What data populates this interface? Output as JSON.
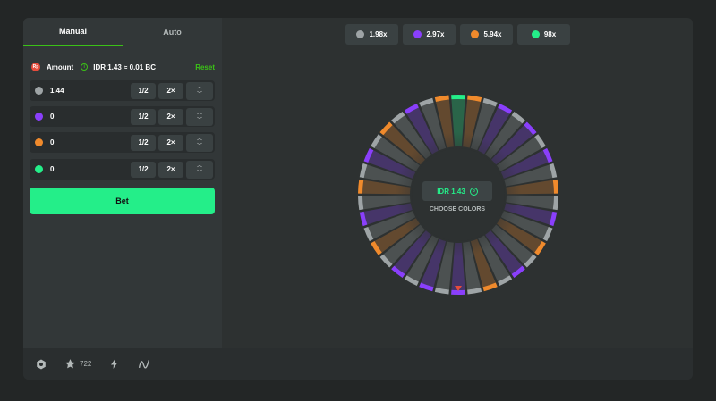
{
  "tabs": [
    {
      "label": "Manual",
      "active": true
    },
    {
      "label": "Auto",
      "active": false
    }
  ],
  "amount": {
    "label": "Amount",
    "coin_symbol": "Rp",
    "conversion": "IDR 1.43 ≈ 0.01 BC",
    "reset_label": "Reset"
  },
  "bets": [
    {
      "color": "#9ea4a6",
      "value": "1.44",
      "half": "1/2",
      "double": "2×",
      "up": "︿",
      "down": "﹀"
    },
    {
      "color": "#8a3ffc",
      "value": "0",
      "half": "1/2",
      "double": "2×",
      "up": "︿",
      "down": "﹀"
    },
    {
      "color": "#f08a2c",
      "value": "0",
      "half": "1/2",
      "double": "2×",
      "up": "︿",
      "down": "﹀"
    },
    {
      "color": "#24ee89",
      "value": "0",
      "half": "1/2",
      "double": "2×",
      "up": "︿",
      "down": "﹀"
    }
  ],
  "bet_button": "Bet",
  "multipliers": [
    {
      "color": "#9ea4a6",
      "label": "1.98x"
    },
    {
      "color": "#8a3ffc",
      "label": "2.97x"
    },
    {
      "color": "#f08a2c",
      "label": "5.94x"
    },
    {
      "color": "#24ee89",
      "label": "98x"
    }
  ],
  "wheel": {
    "segments": [
      "green",
      "orange",
      "grey",
      "purple",
      "grey",
      "purple",
      "grey",
      "purple",
      "grey",
      "orange",
      "grey",
      "purple",
      "grey",
      "orange",
      "grey",
      "purple",
      "grey",
      "orange",
      "grey",
      "purple",
      "grey",
      "purple",
      "grey",
      "purple",
      "grey",
      "orange",
      "grey",
      "purple",
      "grey",
      "orange",
      "grey",
      "purple",
      "grey",
      "orange",
      "grey",
      "purple",
      "grey",
      "orange"
    ],
    "colors": {
      "green": "#24ee89",
      "orange": "#f08a2c",
      "grey": "#9ea4a6",
      "purple": "#8a3ffc"
    }
  },
  "center": {
    "amount": "IDR 1.43",
    "coin_symbol": "b",
    "prompt": "CHOOSE COLORS"
  },
  "footer": {
    "favorites_count": "722"
  }
}
